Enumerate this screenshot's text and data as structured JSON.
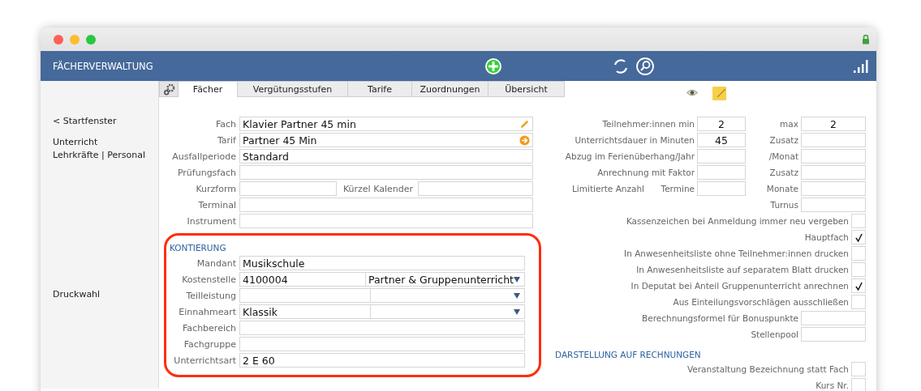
{
  "header": {
    "title": "FÄCHERVERWALTUNG"
  },
  "sidebar": {
    "groups": [
      {
        "items": [
          "< Startfenster"
        ]
      },
      {
        "items": [
          "Unterricht",
          "Lehrkräfte | Personal"
        ]
      },
      {
        "items": [
          "Druckwahl"
        ]
      }
    ]
  },
  "tabs": [
    {
      "label": "Fächer",
      "selected": true
    },
    {
      "label": "Vergütungsstufen",
      "selected": false
    },
    {
      "label": "Tarife",
      "selected": false
    },
    {
      "label": "Zuordnungen",
      "selected": false
    },
    {
      "label": "Übersicht",
      "selected": false
    }
  ],
  "form": {
    "rows": [
      {
        "kind": "edit",
        "label": "Fach",
        "value": "Klavier Partner 45 min"
      },
      {
        "kind": "link",
        "label": "Tarif",
        "value": "Partner 45 Min"
      },
      {
        "kind": "text",
        "label": "Ausfallperiode",
        "value": "Standard"
      },
      {
        "kind": "text",
        "label": "Prüfungsfach"
      },
      {
        "kind": "split",
        "label": "Kurzform",
        "label2": "Kürzel Kalender"
      },
      {
        "kind": "text",
        "label": "Terminal"
      },
      {
        "kind": "text",
        "label": "Instrument"
      }
    ]
  },
  "kontierung": {
    "title": "KONTIERUNG",
    "rows": [
      {
        "kind": "text",
        "label": "Mandant",
        "value": "Musikschule"
      },
      {
        "kind": "select",
        "label": "Kostenstelle",
        "value": "4100004",
        "option": "Partner & Gruppenunterricht"
      },
      {
        "kind": "select",
        "label": "Teilleistung"
      },
      {
        "kind": "select",
        "label": "Einnahmeart",
        "value": "Klassik"
      },
      {
        "kind": "text",
        "label": "Fachbereich"
      },
      {
        "kind": "text",
        "label": "Fachgruppe"
      },
      {
        "kind": "text",
        "label": "Unterrichtsart",
        "value": "2 E 60"
      }
    ]
  },
  "details": {
    "rows": [
      {
        "kind": "pair",
        "label": "Teilnehmer:innen min",
        "value": "2",
        "label2": "max",
        "value2": "2"
      },
      {
        "kind": "pair",
        "label": "Unterrichtsdauer in Minuten",
        "value": "45",
        "label2": "Zusatz"
      },
      {
        "kind": "pair",
        "label": "Abzug im Ferienüberhang/Jahr",
        "label2": "/Monat"
      },
      {
        "kind": "pair",
        "label": "Anrechnung mit Faktor",
        "label2": "Zusatz"
      },
      {
        "kind": "pair",
        "label": "Termine",
        "prefix": "Limitierte Anzahl",
        "label2": "Monate"
      },
      {
        "kind": "pair",
        "label2": "Turnus"
      },
      {
        "kind": "check",
        "label": "Kassenzeichen bei Anmeldung immer neu vergeben",
        "checked": false
      },
      {
        "kind": "check",
        "label": "Hauptfach",
        "checked": true
      },
      {
        "kind": "check",
        "label": "In Anwesenheitsliste ohne Teilnehmer:innen drucken",
        "checked": false
      },
      {
        "kind": "check",
        "label": "In Anwesenheitsliste auf separatem Blatt drucken",
        "checked": false
      },
      {
        "kind": "check",
        "label": "In Deputat bei Anteil Gruppenunterricht anrechnen",
        "checked": true
      },
      {
        "kind": "check",
        "label": "Aus Einteilungsvorschlägen ausschließen",
        "checked": false
      },
      {
        "kind": "wide",
        "label": "Berechnungsformel für Bonuspunkte"
      },
      {
        "kind": "wide",
        "label": "Stellenpool"
      }
    ]
  },
  "invoice": {
    "title": "DARSTELLUNG AUF RECHNUNGEN",
    "rows": [
      {
        "kind": "check",
        "label": "Veranstaltung Bezeichnung statt Fach",
        "checked": false
      },
      {
        "kind": "check",
        "label": "Kurs Nr.",
        "checked": false
      }
    ]
  }
}
